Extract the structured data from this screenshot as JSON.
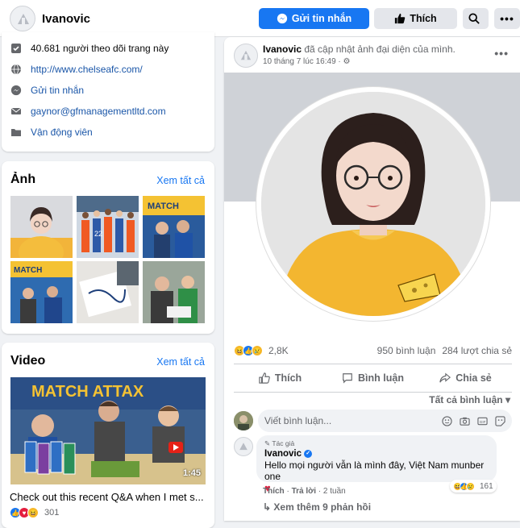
{
  "header": {
    "page_name": "Ivanovic",
    "message_button": "Gửi tin nhắn",
    "like_button": "Thích"
  },
  "about": {
    "followers": "40.681 người theo dõi trang này",
    "website": "http://www.chelseafc.com/",
    "send_message": "Gửi tin nhắn",
    "email": "gaynor@gfmanagementltd.com",
    "category": "Vận động viên"
  },
  "photos": {
    "title": "Ảnh",
    "see_all": "Xem tất cả"
  },
  "video": {
    "title": "Video",
    "see_all": "Xem tất cả",
    "duration": "1:45",
    "caption": "Check out this recent Q&A when I met s...",
    "reaction_count": "301"
  },
  "post": {
    "author": "Ivanovic",
    "action_text": "đã cập nhật ảnh đại diện của mình.",
    "time": "10 tháng 7 lúc 16:49 · ⚙",
    "reaction_count": "2,8K",
    "comments_count": "950 bình luận",
    "shares_count": "284 lượt chia sẻ",
    "like_action": "Thích",
    "comment_action": "Bình luận",
    "share_action": "Chia sẻ",
    "sort_label": "Tất cả bình luận ▾",
    "comment_placeholder": "Viết bình luận..."
  },
  "comment": {
    "badge": "Tác giả",
    "author": "Ivanovic",
    "text": "Hello mọi người vẫn là mình đây, Việt Nam munber one",
    "reaction_count": "161",
    "like": "Thích",
    "reply": "Trả lời",
    "age": "2 tuần",
    "more_replies": "Xem thêm 9 phản hồi"
  },
  "colors": {
    "brand_blue": "#1877f2",
    "background": "#f0f2f5",
    "heart": "#e41e3f"
  }
}
